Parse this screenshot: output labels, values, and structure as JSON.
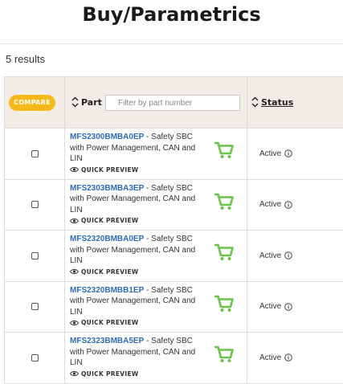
{
  "page": {
    "title": "Buy/Parametrics"
  },
  "results": {
    "count_text": "5 results"
  },
  "table": {
    "compare_label": "COMPARE",
    "part_header": "Part",
    "filter_placeholder": "Filter by part number",
    "status_header": "Status",
    "rows": [
      {
        "part_number": "MFS2300BMBA0EP",
        "description": " - Safety SBC with Power Management, CAN and LIN",
        "preview_label": "QUICK PREVIEW",
        "status": "Active"
      },
      {
        "part_number": "MFS2303BMBA3EP",
        "description": " - Safety SBC with Power Management, CAN and LIN",
        "preview_label": "QUICK PREVIEW",
        "status": "Active"
      },
      {
        "part_number": "MFS2320BMBA0EP",
        "description": " - Safety SBC with Power Management, CAN and LIN",
        "preview_label": "QUICK PREVIEW",
        "status": "Active"
      },
      {
        "part_number": "MFS2320BMBB1EP",
        "description": " - Safety SBC with Power Management, CAN and LIN",
        "preview_label": "QUICK PREVIEW",
        "status": "Active"
      },
      {
        "part_number": "MFS2323BMBA5EP",
        "description": " - Safety SBC with Power Management, CAN and LIN",
        "preview_label": "QUICK PREVIEW",
        "status": "Active"
      }
    ]
  },
  "colors": {
    "accent": "#f5b91c",
    "link": "#2f6bb8",
    "cart": "#6cc24a",
    "header_bg": "#f1ede6"
  },
  "icons": {
    "sort": "sort-icon",
    "eye": "eye-icon",
    "cart": "cart-icon",
    "info": "info-icon"
  }
}
